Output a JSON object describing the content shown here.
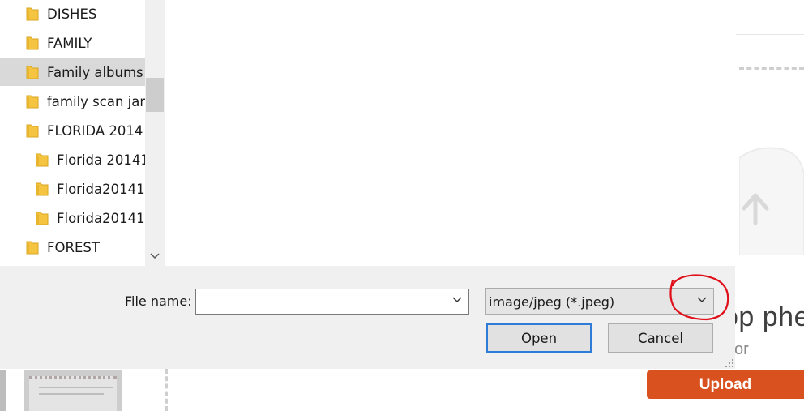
{
  "dialog": {
    "folders": [
      {
        "label": "DISHES",
        "level": 0,
        "selected": false
      },
      {
        "label": "FAMILY",
        "level": 0,
        "selected": false
      },
      {
        "label": "Family albums",
        "level": 0,
        "selected": true
      },
      {
        "label": "family scan jan",
        "level": 0,
        "selected": false
      },
      {
        "label": "FLORIDA 2014",
        "level": 0,
        "selected": false
      },
      {
        "label": "Florida 20141",
        "level": 1,
        "selected": false
      },
      {
        "label": "Florida20141",
        "level": 1,
        "selected": false
      },
      {
        "label": "Florida20141",
        "level": 1,
        "selected": false
      },
      {
        "label": "FOREST",
        "level": 0,
        "selected": false
      }
    ],
    "file_name_label": "File name:",
    "file_name_value": "",
    "file_type_filter": "image/jpeg (*.jpeg)",
    "open_label": "Open",
    "cancel_label": "Cancel"
  },
  "background_page": {
    "headline_partial": "op phe",
    "subline_partial": "or",
    "upload_label": "Upload"
  },
  "colors": {
    "upload": "#d9511f",
    "dialog_border": "#9d4f9a",
    "focus_ring": "#2e7bd8",
    "annotation": "#e0101a",
    "folder": "#f5c542"
  },
  "icons": {
    "folder": "folder-icon",
    "scroll_down": "chevron-down-icon",
    "dropdown": "chevron-down-icon",
    "resize": "resize-grip-icon",
    "cloud_upload": "cloud-upload-icon"
  }
}
